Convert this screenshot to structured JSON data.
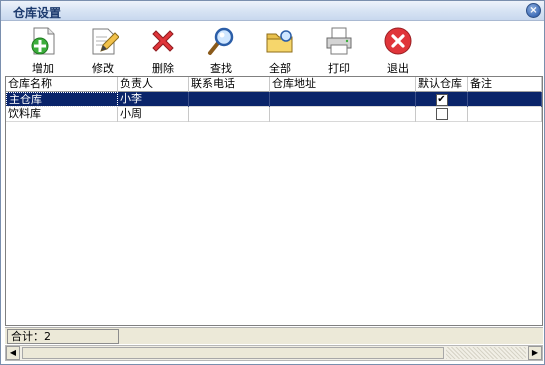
{
  "window": {
    "title": "仓库设置"
  },
  "toolbar": {
    "buttons": [
      {
        "label": "增加",
        "icon": "add-document-icon"
      },
      {
        "label": "修改",
        "icon": "edit-document-icon"
      },
      {
        "label": "删除",
        "icon": "delete-x-icon"
      },
      {
        "label": "查找",
        "icon": "magnifier-icon"
      },
      {
        "label": "全部",
        "icon": "folder-icon"
      },
      {
        "label": "打印",
        "icon": "printer-icon"
      },
      {
        "label": "退出",
        "icon": "exit-icon"
      }
    ]
  },
  "table": {
    "columns": [
      "仓库名称",
      "负责人",
      "联系电话",
      "仓库地址",
      "默认仓库",
      "备注"
    ],
    "rows": [
      {
        "name": "主仓库",
        "manager": "小李",
        "phone": "",
        "address": "",
        "default": true,
        "remark": ""
      },
      {
        "name": "饮料库",
        "manager": "小周",
        "phone": "",
        "address": "",
        "default": false,
        "remark": ""
      }
    ]
  },
  "status": {
    "total": "合计：2"
  },
  "colors": {
    "selection": "#0a246a",
    "title_text": "#1c3a6e"
  }
}
